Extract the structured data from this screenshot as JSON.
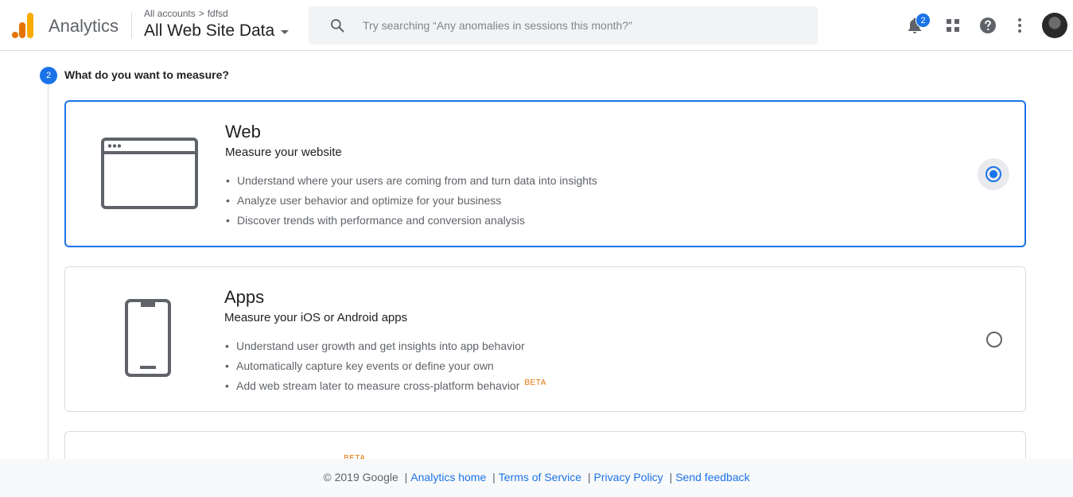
{
  "header": {
    "app_name": "Analytics",
    "breadcrumb": {
      "account": "All accounts",
      "separator": ">",
      "property": "fdfsd"
    },
    "view_selector": "All Web Site Data",
    "search": {
      "placeholder": "Try searching “Any anomalies in sessions this month?”",
      "value": ""
    },
    "notifications_count": "2",
    "icons": [
      "search-icon",
      "bell-icon",
      "apps-grid-icon",
      "help-icon",
      "more-vert-icon"
    ]
  },
  "step": {
    "number": "2",
    "title": "What do you want to measure?"
  },
  "options": [
    {
      "title": "Web",
      "subtitle": "Measure your website",
      "bullets": [
        "Understand where your users are coming from and turn data into insights",
        "Analyze user behavior and optimize for your business",
        "Discover trends with performance and conversion analysis"
      ],
      "selected": true,
      "icon": "browser-window-icon"
    },
    {
      "title": "Apps",
      "subtitle": "Measure your iOS or Android apps",
      "bullets": [
        "Understand user growth and get insights into app behavior",
        "Automatically capture key events or define your own",
        "Add web stream later to measure cross-platform behavior"
      ],
      "bullet_badge": "BETA",
      "selected": false,
      "icon": "smartphone-icon"
    },
    {
      "badge": "BETA"
    }
  ],
  "footer": {
    "copyright": "© 2019 Google",
    "links": [
      "Analytics home",
      "Terms of Service",
      "Privacy Policy",
      "Send feedback"
    ],
    "separator": "|"
  },
  "colors": {
    "accent": "#1a73e8",
    "beta": "#e37400",
    "logo_dark": "#e37400",
    "logo_light": "#f9ab00"
  }
}
